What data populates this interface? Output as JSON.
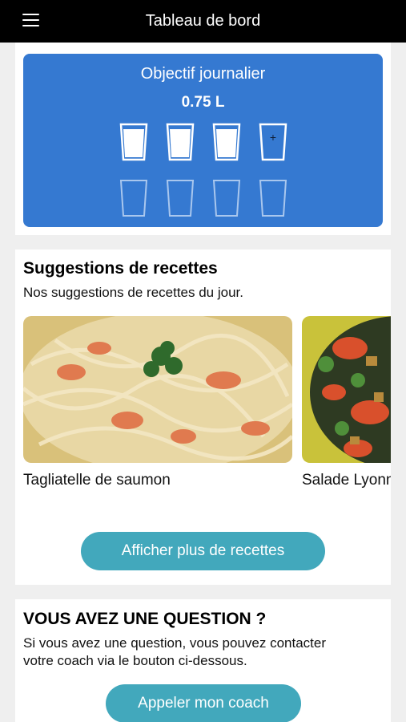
{
  "header": {
    "title": "Tableau de bord",
    "menu_icon": "hamburger-menu-icon"
  },
  "water": {
    "title": "Objectif journalier",
    "amount": "0.75 L",
    "glasses_row1": [
      {
        "state": "full"
      },
      {
        "state": "full"
      },
      {
        "state": "full"
      },
      {
        "state": "add",
        "symbol": "+"
      }
    ],
    "glasses_row2": [
      {
        "state": "empty"
      },
      {
        "state": "empty"
      },
      {
        "state": "empty"
      },
      {
        "state": "empty"
      }
    ],
    "colors": {
      "panel": "#3579d1",
      "glass_outline": "#ffffff",
      "glass_empty_outline": "#a9c7ee"
    }
  },
  "recipes": {
    "title": "Suggestions de recettes",
    "subtitle": "Nos suggestions de recettes du  jour.",
    "items": [
      {
        "name": "Tagliatelle de saumon",
        "image": "pasta-salmon-photo"
      },
      {
        "name": "Salade Lyonnaise",
        "image": "salad-photo"
      }
    ],
    "more_button": "Afficher plus de recettes"
  },
  "question": {
    "title": "VOUS AVEZ UNE QUESTION ?",
    "text_line1": "Si vous avez une question, vous pouvez contacter",
    "text_line2": "votre coach via le bouton ci-dessous.",
    "call_button": "Appeler mon coach"
  },
  "colors": {
    "accent_button": "#42a8bc",
    "header_bg": "#000000",
    "page_bg": "#efefef"
  }
}
